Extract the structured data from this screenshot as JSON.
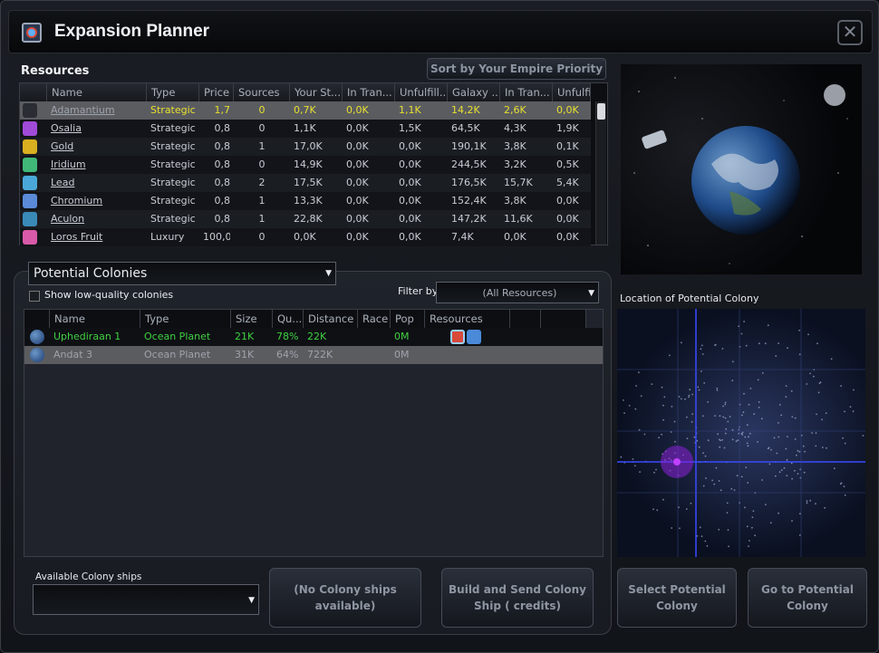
{
  "window": {
    "title": "Expansion Planner",
    "close_label": "✕",
    "icon": "expansion-planner-icon"
  },
  "resources": {
    "label": "Resources",
    "sort_button": "Sort by Your Empire Priority",
    "columns": [
      "Name",
      "Type",
      "Price",
      "Sources",
      "Your St...",
      "In Tran...",
      "Unfulfill...",
      "Galaxy ...",
      "In Tran...",
      "Unfulfi"
    ],
    "rows": [
      {
        "name": "Adamantium",
        "type": "Strategic",
        "price": "1,7",
        "sources": "0",
        "your_stock": "0,7K",
        "in_transit": "0,0K",
        "unfulfilled": "1,1K",
        "galaxy": "14,2K",
        "in_transit2": "2,6K",
        "unfulfilled2": "0,0K",
        "selected": true,
        "icon_color": "#2a2d33"
      },
      {
        "name": "Osalia",
        "type": "Strategic",
        "price": "0,8",
        "sources": "0",
        "your_stock": "1,1K",
        "in_transit": "0,0K",
        "unfulfilled": "1,5K",
        "galaxy": "64,5K",
        "in_transit2": "4,3K",
        "unfulfilled2": "1,9K",
        "selected": false,
        "icon_color": "#a04ad8"
      },
      {
        "name": "Gold",
        "type": "Strategic",
        "price": "0,8",
        "sources": "1",
        "your_stock": "17,0K",
        "in_transit": "0,0K",
        "unfulfilled": "0,0K",
        "galaxy": "190,1K",
        "in_transit2": "3,8K",
        "unfulfilled2": "0,1K",
        "selected": false,
        "icon_color": "#d8b020"
      },
      {
        "name": "Iridium",
        "type": "Strategic",
        "price": "0,8",
        "sources": "0",
        "your_stock": "14,9K",
        "in_transit": "0,0K",
        "unfulfilled": "0,0K",
        "galaxy": "244,5K",
        "in_transit2": "3,2K",
        "unfulfilled2": "0,5K",
        "selected": false,
        "icon_color": "#40b878"
      },
      {
        "name": "Lead",
        "type": "Strategic",
        "price": "0,8",
        "sources": "2",
        "your_stock": "17,5K",
        "in_transit": "0,0K",
        "unfulfilled": "0,0K",
        "galaxy": "176,5K",
        "in_transit2": "15,7K",
        "unfulfilled2": "5,4K",
        "selected": false,
        "icon_color": "#4aa8d8"
      },
      {
        "name": "Chromium",
        "type": "Strategic",
        "price": "0,8",
        "sources": "1",
        "your_stock": "13,3K",
        "in_transit": "0,0K",
        "unfulfilled": "0,0K",
        "galaxy": "152,4K",
        "in_transit2": "3,8K",
        "unfulfilled2": "0,0K",
        "selected": false,
        "icon_color": "#5a8ad8"
      },
      {
        "name": "Aculon",
        "type": "Strategic",
        "price": "0,8",
        "sources": "1",
        "your_stock": "22,8K",
        "in_transit": "0,0K",
        "unfulfilled": "0,0K",
        "galaxy": "147,2K",
        "in_transit2": "11,6K",
        "unfulfilled2": "0,0K",
        "selected": false,
        "icon_color": "#3a8ab8"
      },
      {
        "name": "Loros Fruit",
        "type": "Luxury",
        "price": "100,0",
        "sources": "0",
        "your_stock": "0,0K",
        "in_transit": "0,0K",
        "unfulfilled": "0,0K",
        "galaxy": "7,4K",
        "in_transit2": "0,0K",
        "unfulfilled2": "0,0K",
        "selected": false,
        "icon_color": "#d85aa8"
      }
    ]
  },
  "colonies": {
    "dropdown_value": "Potential Colonies",
    "show_low_quality": "Show low-quality colonies",
    "filter_label": "Filter by",
    "filter_value": "(All Resources)",
    "columns": [
      "Name",
      "Type",
      "Size",
      "Qu...",
      "Distance",
      "Race",
      "Pop",
      "Resources"
    ],
    "rows": [
      {
        "name": "Uphediraan 1",
        "type": "Ocean Planet",
        "size": "21K",
        "quality": "78%",
        "distance": "22K",
        "race": "",
        "pop": "0M",
        "highlight": true
      },
      {
        "name": "Andat 3",
        "type": "Ocean Planet",
        "size": "31K",
        "quality": "64%",
        "distance": "722K",
        "race": "",
        "pop": "0M",
        "highlight": false
      }
    ]
  },
  "map": {
    "label": "Location of Potential Colony"
  },
  "footer": {
    "ships_label": "Available Colony ships",
    "no_ships": "(No Colony ships available)",
    "build_send": "Build and Send Colony Ship ( credits)",
    "select_potential": "Select Potential Colony",
    "goto_potential": "Go to Potential Colony"
  },
  "colors": {
    "accent_yellow": "#e8e030",
    "accent_green": "#40d040",
    "selected_row": "#5a5c60"
  }
}
